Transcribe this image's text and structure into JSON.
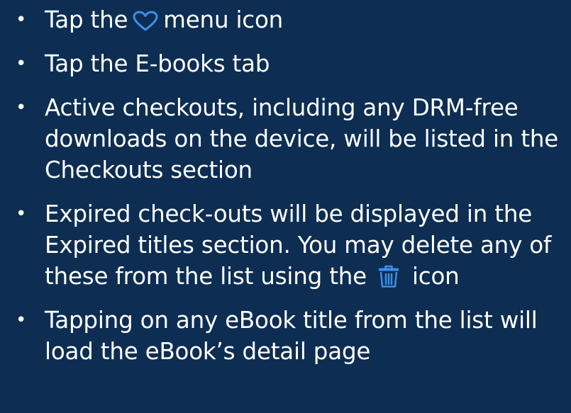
{
  "colors": {
    "background": "#0d2d52",
    "text": "#ffffff",
    "icon_accent": "#3d8fe8"
  },
  "icons": {
    "menu": "heart-icon",
    "delete": "trash-icon"
  },
  "bullets": [
    {
      "before": "Tap the",
      "after": "menu icon"
    },
    {
      "text": "Tap the E-books tab"
    },
    {
      "text": "Active checkouts, including any DRM-free downloads on the device, will be listed in the Checkouts section"
    },
    {
      "before": "Expired check-outs will be displayed in the Expired titles section. You may delete any of these from the list using the",
      "after": "icon"
    },
    {
      "text": "Tapping on any eBook title from the list will load the eBook’s detail page"
    }
  ]
}
